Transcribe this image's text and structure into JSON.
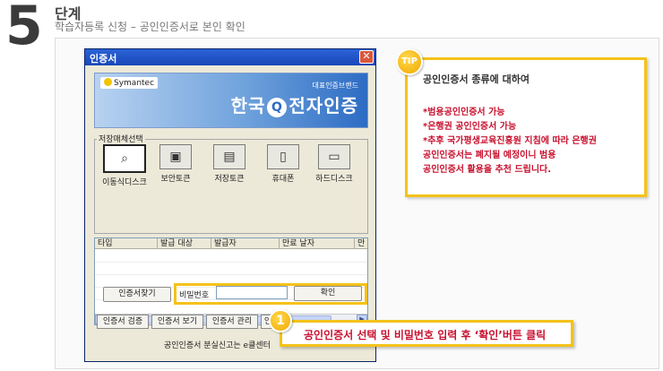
{
  "step": {
    "number": "5",
    "title": "단계",
    "subtitle": "학습자등록 신청 – 공인인증서로 본인 확인"
  },
  "dialog": {
    "title": "인증서",
    "close_icon": "close-icon",
    "banner": {
      "vendor": "Symantec",
      "brand_sub": "대표인증브랜드",
      "brand_main_left": "한국",
      "brand_q": "Q",
      "brand_main_right": "전자인증"
    },
    "storage_label": "저장매체선택",
    "media": [
      {
        "label": "이동식디스크",
        "icon": "removable-disk-icon",
        "glyph": "⌕",
        "selected": true
      },
      {
        "label": "보안토큰",
        "icon": "security-token-icon",
        "glyph": "▣"
      },
      {
        "label": "저장토큰",
        "icon": "storage-token-icon",
        "glyph": "▤"
      },
      {
        "label": "휴대폰",
        "icon": "mobile-phone-icon",
        "glyph": "▯"
      },
      {
        "label": "하드디스크",
        "icon": "hard-disk-icon",
        "glyph": "▭"
      }
    ],
    "columns": [
      "타입",
      "발급 대상",
      "발급자",
      "만료 날자",
      "만"
    ],
    "find_cert_button": "인증서찾기",
    "password_label": "비밀번호",
    "password_value": "",
    "confirm_button": "확인",
    "footer_buttons": [
      "인증서 검증",
      "인증서 보기",
      "인증서 관리",
      "인"
    ],
    "footer_text": "공인인증서 분실신고는",
    "footer_text_tail": "e클센터"
  },
  "callout": {
    "badge": "1",
    "text": "공인인증서 선택 및 비밀번호 입력 후 ‘확인’버튼 클릭"
  },
  "tip": {
    "badge": "TIP",
    "title": "공인인증서 종류에 대하여",
    "lines": [
      "*범용공인인증서 가능",
      "*은행권 공인인증서 가능",
      "*추후 국가평생교육진흥원 지침에 따라 은행권",
      "공인인증서는 폐지될 예정이니 범용",
      "공인인증서 활용을 추천 드립니다."
    ]
  },
  "colors": {
    "accent": "#f4c21a",
    "highlight_text": "#c8102e",
    "titlebar": "#2a63d7"
  }
}
